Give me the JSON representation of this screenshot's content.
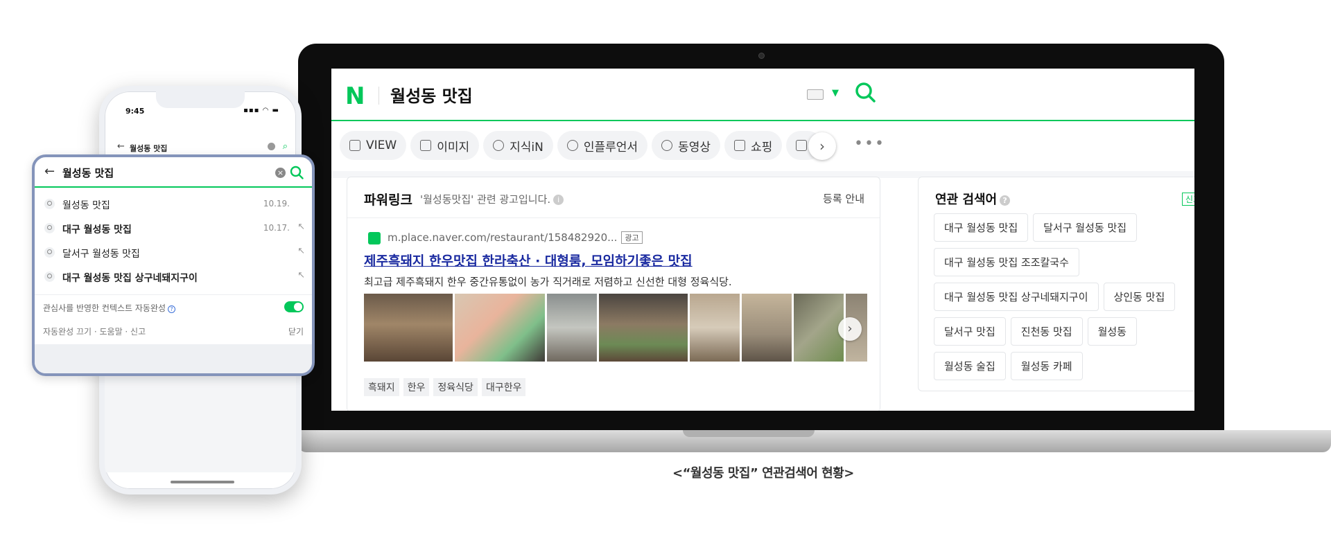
{
  "laptop": {
    "header": {
      "logo": "N",
      "query": "월성동 맛집"
    },
    "tabs": [
      {
        "label": "VIEW",
        "icon": "document-icon"
      },
      {
        "label": "이미지",
        "icon": "image-icon"
      },
      {
        "label": "지식iN",
        "icon": "q-icon"
      },
      {
        "label": "인플루언서",
        "icon": "person-icon"
      },
      {
        "label": "동영상",
        "icon": "play-icon"
      },
      {
        "label": "쇼핑",
        "icon": "bag-icon"
      },
      {
        "label": "",
        "icon": "news-icon"
      }
    ],
    "tabs_next": "›",
    "tabs_more": "•••",
    "powerlink": {
      "title": "파워링크",
      "subtitle": "'월성동맛집' 관련 광고입니다.",
      "register": "등록 안내",
      "url": "m.place.naver.com/restaurant/158482920...",
      "ad_badge": "광고",
      "ad_title": "제주흑돼지 한우맛집 한라축산 · 대형룸, 모임하기좋은 맛집",
      "ad_desc": "최고급 제주흑돼지 한우 중간유통없이 농가 직거래로 저렴하고 신선한 대형 정육식당.",
      "image_next": "›",
      "tags": [
        "흑돼지",
        "한우",
        "정육식당",
        "대구한우"
      ]
    },
    "related": {
      "title": "연관 검색어",
      "badge": "신고",
      "chips": [
        "대구 월성동 맛집",
        "달서구 월성동 맛집",
        "대구 월성동 맛집 조조칼국수",
        "대구 월성동 맛집 상구네돼지구이",
        "상인동 맛집",
        "달서구 맛집",
        "진천동 맛집",
        "월성동",
        "월성동 술집",
        "월성동 카페"
      ]
    }
  },
  "phone": {
    "time": "9:45",
    "status": "▪▪▪ ◠ ▬",
    "search_query": "월성동 맛집"
  },
  "autocomplete": {
    "query": "월성동 맛집",
    "items": [
      {
        "text": "월성동 맛집",
        "date": "10.19.",
        "bold": false
      },
      {
        "text": "대구 월성동 맛집",
        "date": "10.17.",
        "bold": true
      },
      {
        "text": "달서구 월성동 맛집",
        "date": "",
        "bold": false
      },
      {
        "text": "대구 월성동 맛집 상구네돼지구이",
        "date": "",
        "bold": true
      }
    ],
    "context_label": "관심사를 반영한 컨텍스트 자동완성",
    "footer": "자동완성 끄기 · 도움말 · 신고",
    "close": "닫기"
  },
  "caption": "<“월성동 맛집” 연관검색어 현황>",
  "colors": {
    "naver_green": "#03c75a",
    "link_blue": "#1a2aa0",
    "frame_blue": "#8494ba"
  }
}
